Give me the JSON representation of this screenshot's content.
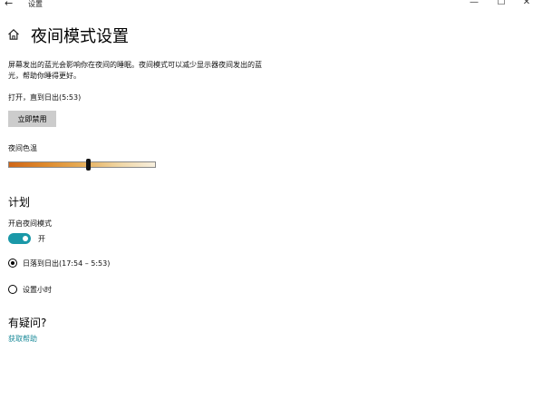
{
  "window": {
    "back_glyph": "←",
    "title": "设置",
    "minimize_glyph": "—",
    "maximize_glyph": "☐",
    "close_glyph": "✕"
  },
  "page": {
    "title": "夜间模式设置"
  },
  "description": "屏幕发出的蓝光会影响你在夜间的睡眠。夜间模式可以减少显示器夜间发出的蓝光，帮助你睡得更好。",
  "status_text": "打开，直到日出(5:53)",
  "disable_button_label": "立即禁用",
  "color_temperature": {
    "label": "夜间色温",
    "value_fraction": 0.54,
    "gradient_colors": [
      "#cf6617",
      "#de8a2d",
      "#e6ad58",
      "#efd5a3",
      "#f7efde"
    ]
  },
  "schedule": {
    "heading": "计划",
    "toggle_label": "开启夜间模式",
    "toggle_state_text": "开",
    "toggle_on": true,
    "toggle_color": "#1a98a8",
    "options": [
      {
        "label": "日落到日出(17:54 – 5:53)",
        "selected": true
      },
      {
        "label": "设置小时",
        "selected": false
      }
    ]
  },
  "help": {
    "heading": "有疑问?",
    "link_label": "获取帮助",
    "link_color": "#1a8a99"
  }
}
